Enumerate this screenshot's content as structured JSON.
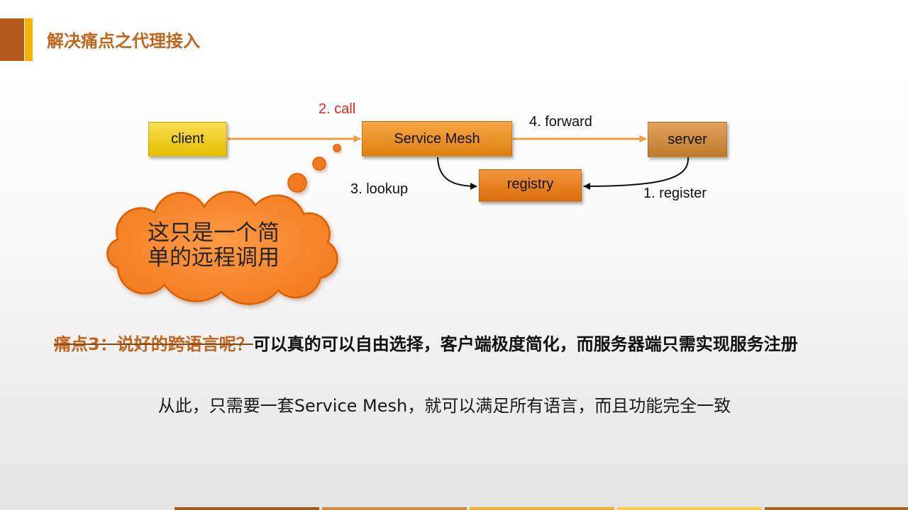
{
  "slide": {
    "title": "解决痛点之代理接入"
  },
  "diagram": {
    "nodes": {
      "client": "client",
      "service_mesh": "Service Mesh",
      "server": "server",
      "registry": "registry"
    },
    "edges": {
      "call": "2. call",
      "forward": "4. forward",
      "lookup": "3. lookup",
      "register": "1. register"
    }
  },
  "callout": {
    "lines": [
      "这只是一个简",
      "单的远程调用"
    ]
  },
  "pain_point": {
    "struck": "痛点3：说好的跨语言呢？",
    "text": "可以真的可以自由选择，客户端极度简化，而服务器端只需实现服务注册"
  },
  "conclusion": "从此，只需要一套Service Mesh，就可以满足所有语言，而且功能完全一致",
  "colors": {
    "accent_brown": "#B35A1C",
    "accent_gold": "#F5B300",
    "title_text": "#C0661C",
    "call_label": "#E0261E",
    "client_box": "#F7CF00",
    "service_mesh_box": "#F68E12",
    "server_box": "#D98A30",
    "registry_box": "#F27A0C",
    "callout_fill": "#F27A1E",
    "flow_arrow": "#EEA040",
    "lookup_arrow": "#111111",
    "struck_text": "#C0661C"
  },
  "footer_bar_colors": [
    "#A85A1E",
    "#D48A3C",
    "#F0B12E",
    "#FFCB45",
    "#B0621F"
  ]
}
